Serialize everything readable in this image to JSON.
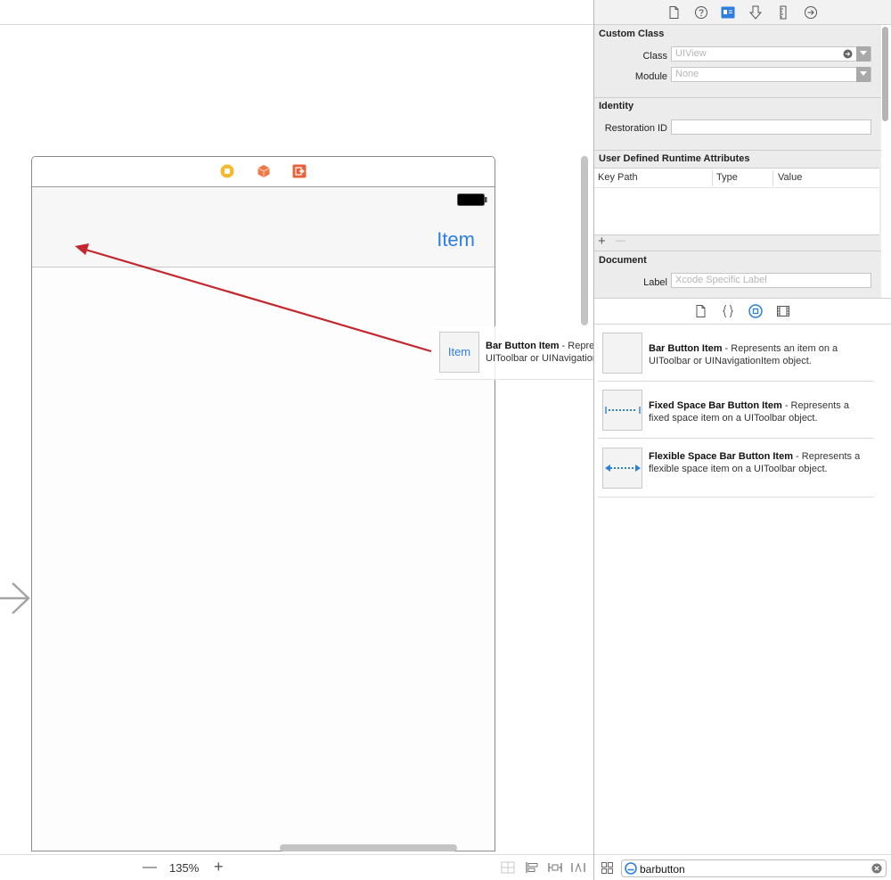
{
  "canvas": {
    "navbar_item_label": "Item",
    "zoom": {
      "out_symbol": "—",
      "level": "135%",
      "in_symbol": "+"
    }
  },
  "drag_preview": {
    "thumb_label": "Item",
    "title": "Bar Button Item",
    "description": "Represents an item on a UIToolbar or UINavigationItem object."
  },
  "inspector": {
    "custom_class": {
      "title": "Custom Class",
      "class_label": "Class",
      "class_placeholder": "UIView",
      "module_label": "Module",
      "module_placeholder": "None"
    },
    "identity": {
      "title": "Identity",
      "restoration_label": "Restoration ID",
      "restoration_value": ""
    },
    "runtime_attributes": {
      "title": "User Defined Runtime Attributes",
      "columns": [
        "Key Path",
        "Type",
        "Value"
      ],
      "add_symbol": "+",
      "remove_symbol": "—"
    },
    "document": {
      "title": "Document",
      "label_label": "Label",
      "label_placeholder": "Xcode Specific Label"
    }
  },
  "library": {
    "items": [
      {
        "icon": "bar-button-item-icon",
        "title_visible": "Bar Button Item",
        "description": "Represents an item on a UIToolbar or UINavigationItem object."
      },
      {
        "icon": "fixed-space-icon",
        "title": "Fixed Space Bar Button Item",
        "description": "Represents a fixed space item on a UIToolbar object."
      },
      {
        "icon": "flexible-space-icon",
        "title": "Flexible Space Bar Button Item",
        "description": "Represents a flexible space item on a UIToolbar object."
      }
    ],
    "filter": {
      "value": "barbutton"
    }
  },
  "colors": {
    "accent_blue": "#2e7ee0",
    "drag_arrow_red": "#c4262d",
    "view_controller_yellow": "#f5b82e",
    "first_responder_orange": "#ee7744",
    "exit_red_orange": "#e9603a"
  }
}
